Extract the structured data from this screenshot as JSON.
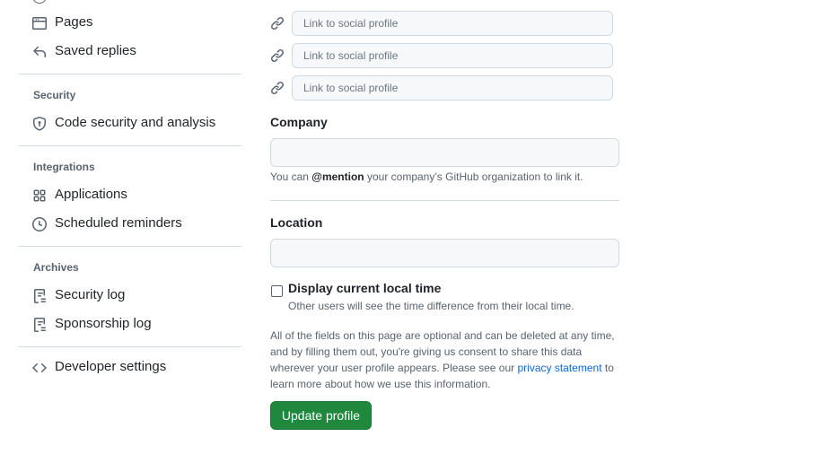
{
  "sidebar": {
    "items_top": [
      {
        "label": "Pages",
        "icon": "browser-icon"
      },
      {
        "label": "Saved replies",
        "icon": "reply-icon"
      }
    ],
    "security": {
      "heading": "Security",
      "items": [
        {
          "label": "Code security and analysis",
          "icon": "shield-lock-icon"
        }
      ]
    },
    "integrations": {
      "heading": "Integrations",
      "items": [
        {
          "label": "Applications",
          "icon": "apps-icon"
        },
        {
          "label": "Scheduled reminders",
          "icon": "clock-icon"
        }
      ]
    },
    "archives": {
      "heading": "Archives",
      "items": [
        {
          "label": "Security log",
          "icon": "log-icon"
        },
        {
          "label": "Sponsorship log",
          "icon": "log-icon"
        }
      ]
    },
    "developer": {
      "label": "Developer settings",
      "icon": "code-icon"
    }
  },
  "main": {
    "social_links": [
      {
        "placeholder": "Link to social profile",
        "value": ""
      },
      {
        "placeholder": "Link to social profile",
        "value": ""
      },
      {
        "placeholder": "Link to social profile",
        "value": ""
      }
    ],
    "company": {
      "label": "Company",
      "value": "",
      "note_prefix": "You can ",
      "note_mention": "@mention",
      "note_suffix": " your company’s GitHub organization to link it."
    },
    "location": {
      "label": "Location",
      "value": ""
    },
    "local_time": {
      "label": "Display current local time",
      "checked": false,
      "note": "Other users will see the time difference from their local time."
    },
    "disclaimer": {
      "text": "All of the fields on this page are optional and can be deleted at any time, and by filling them out, you're giving us consent to share this data wherever your user profile appears. Please see our ",
      "link": "privacy statement",
      "suffix": " to learn more about how we use this information."
    },
    "submit_label": "Update profile"
  },
  "colors": {
    "accent": "#1f883d",
    "link": "#0969da",
    "muted": "#59636e",
    "border": "#d1d9e0"
  }
}
